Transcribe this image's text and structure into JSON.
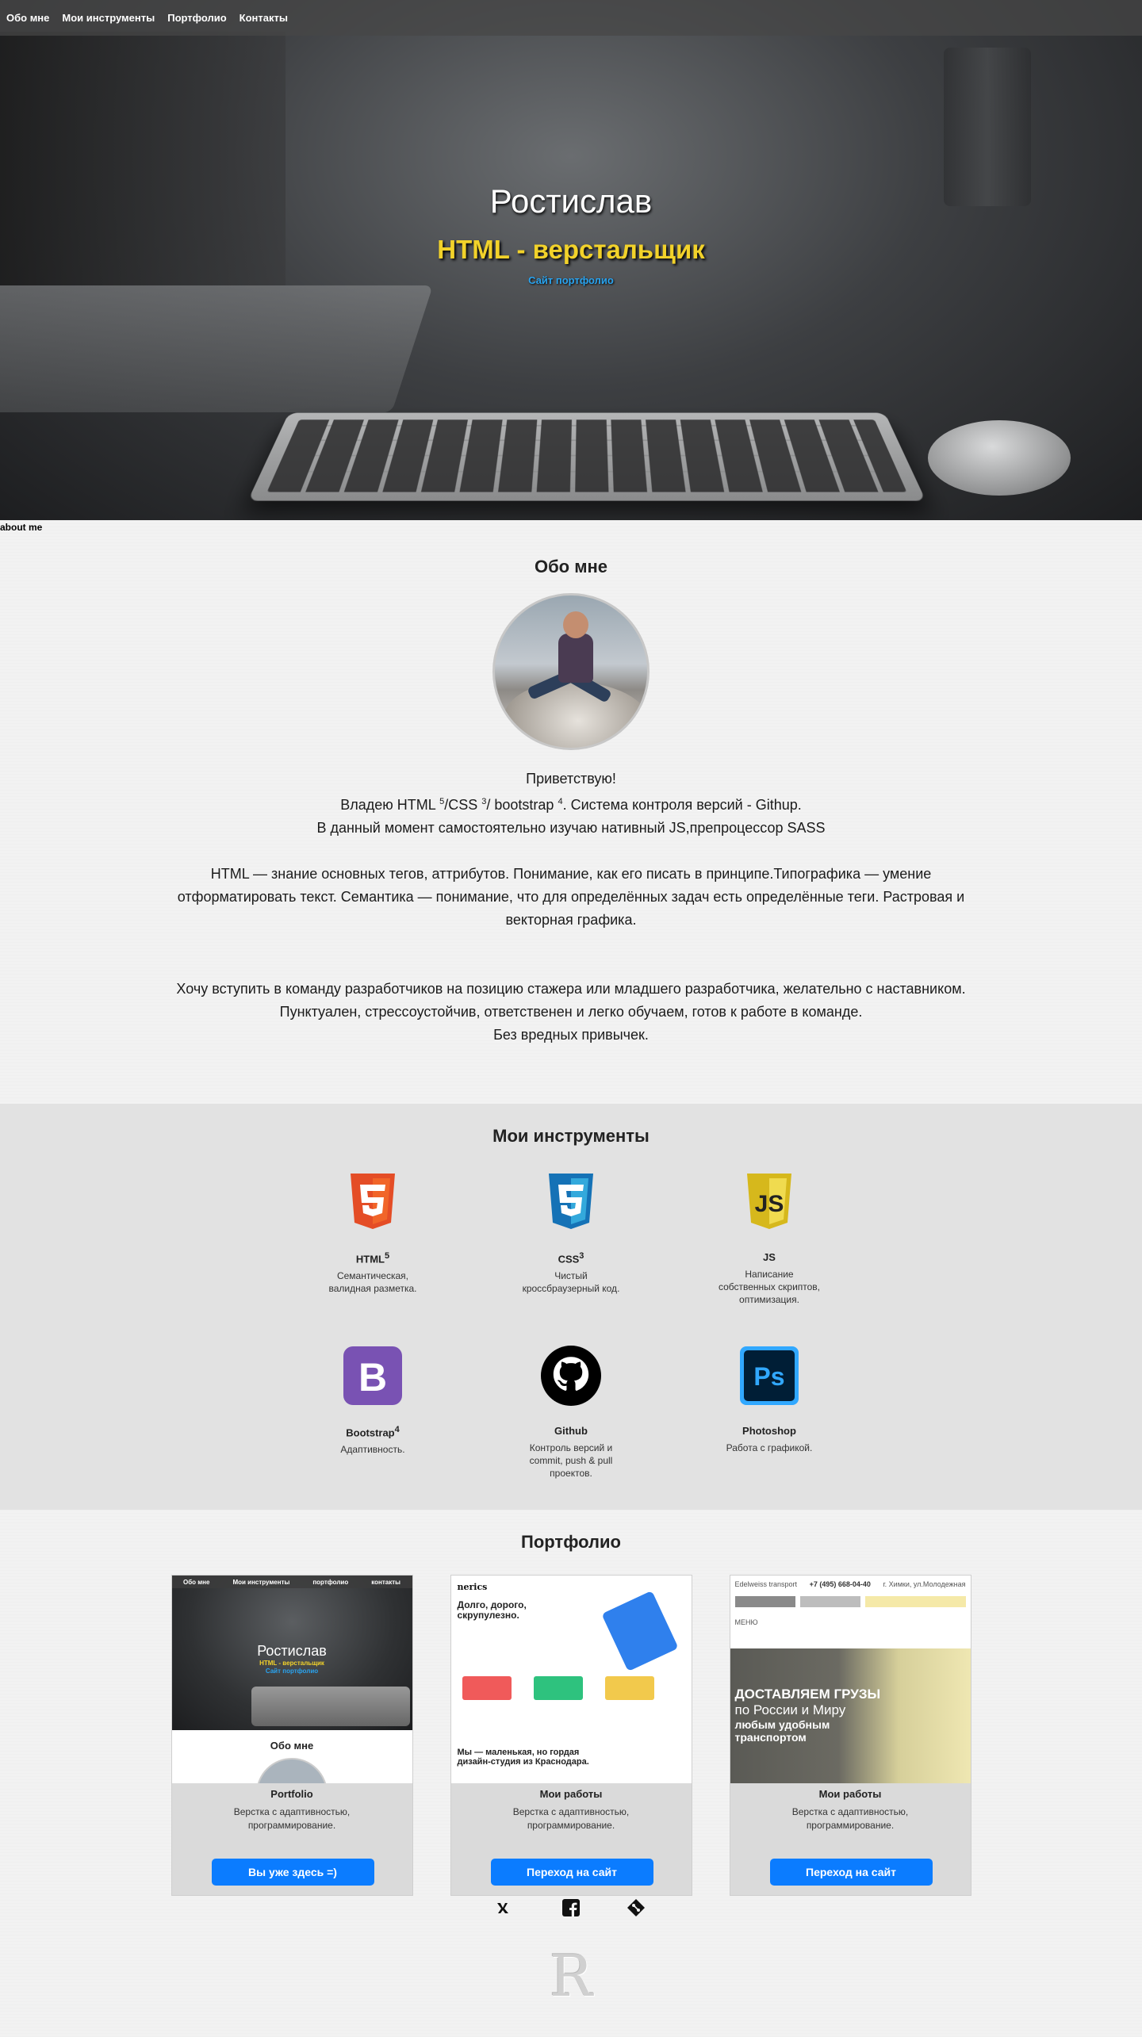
{
  "nav": {
    "items": [
      "Обо мне",
      "Мои инструменты",
      "Портфолио",
      "Контакты"
    ]
  },
  "hero": {
    "name": "Ростислав",
    "role": "HTML - верстальщик",
    "link": "Сайт портфолио"
  },
  "anchor_label": "about me",
  "about": {
    "title": "Обо мне",
    "greeting": "Приветствую!",
    "line1_a": "Владею HTML ",
    "line1_sup1": "5",
    "line1_b": "/CSS ",
    "line1_sup2": "3",
    "line1_c": "/ bootstrap ",
    "line1_sup3": "4",
    "line1_d": ". Система контроля версий - Githup.",
    "line2": "В данный момент самостоятельно изучаю нативный JS,препроцессор SASS",
    "para2": "HTML — знание основных тегов, аттрибутов. Понимание, как его писать в принципе.Типографика — умение отформатировать текст. Семантика — понимание, что для определённых задач есть определённые теги. Растровая и векторная графика.",
    "para3_l1": "Хочу вступить в команду разработчиков на позицию стажера или младшего разработчика, желательно с наставником.",
    "para3_l2": "Пунктуален, стрессоустойчив, ответственен и легко обучаем, готов к работе в команде.",
    "para3_l3": "Без вредных привычек."
  },
  "tools": {
    "title": "Мои инструменты",
    "items": [
      {
        "name": "HTML",
        "sup": "5",
        "desc": "Семантическая, валидная разметка.",
        "icon": "html5-icon",
        "color": "#e44d26"
      },
      {
        "name": "CSS",
        "sup": "3",
        "desc": "Чистый кроссбраузерный код.",
        "icon": "css3-icon",
        "color": "#1572b6"
      },
      {
        "name": "JS",
        "sup": "",
        "desc": "Написание собственных скриптов, оптимизация.",
        "icon": "js-icon",
        "color": "#f0db4f"
      },
      {
        "name": "Bootstrap",
        "sup": "4",
        "desc": "Адаптивность.",
        "icon": "bootstrap-icon",
        "color": "#7952b3"
      },
      {
        "name": "Github",
        "sup": "",
        "desc": "Контроль версий и commit, push & pull проектов.",
        "icon": "github-icon",
        "color": "#000000"
      },
      {
        "name": "Photoshop",
        "sup": "",
        "desc": "Работа с графикой.",
        "icon": "photoshop-icon",
        "color": "#31a8ff"
      }
    ]
  },
  "portfolio": {
    "title": "Портфолио",
    "cards": [
      {
        "title": "Portfolio",
        "desc_l1": "Верстка с адаптивностью,",
        "desc_l2": "программирование.",
        "button": "Вы уже здесь =)"
      },
      {
        "title": "Мои работы",
        "desc_l1": "Верстка с адаптивностью,",
        "desc_l2": "программирование.",
        "button": "Переход на сайт"
      },
      {
        "title": "Мои работы",
        "desc_l1": "Верстка с адаптивностью,",
        "desc_l2": "программирование.",
        "button": "Переход на сайт"
      }
    ],
    "shot1": {
      "nav": [
        "Обо мне",
        "Мои инструменты",
        "портфолио",
        "контакты"
      ],
      "name": "Ростислав",
      "role": "HTML - верстальщик",
      "link": "Сайт портфолио",
      "about": "Обо мне"
    },
    "shot2": {
      "logo": "nerics",
      "headline_l1": "Долго, дорого,",
      "headline_l2": "скрупулезно.",
      "bottom_l1": "Мы — маленькая, но гордая",
      "bottom_l2": "дизайн-студия из Краснодара."
    },
    "shot3": {
      "brand": "Edelweiss transport",
      "phone": "+7 (495) 668-04-40",
      "addr": "г. Химки, ул.Молодежная",
      "menu": "МЕНЮ",
      "hero_l1": "ДОСТАВЛЯЕМ ГРУЗЫ",
      "hero_l2": "по России и Миру",
      "hero_l3": "любым удобным",
      "hero_l4": "транспортом"
    }
  },
  "footer": {
    "socials": [
      "vk-icon",
      "facebook-icon",
      "git-icon"
    ],
    "logo": "R"
  }
}
